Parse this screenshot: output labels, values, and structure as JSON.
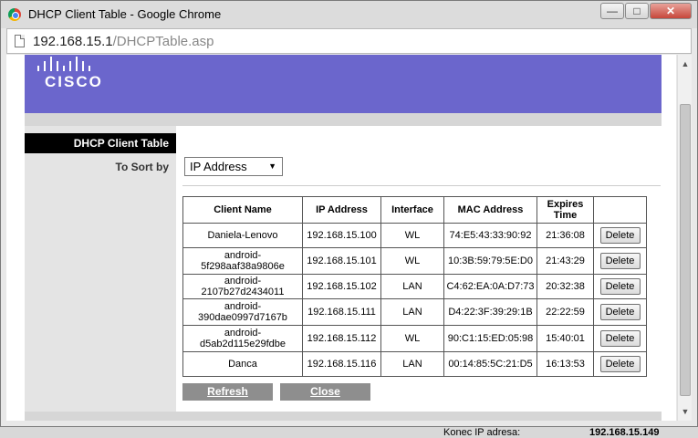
{
  "window": {
    "title": "DHCP Client Table - Google Chrome",
    "minimize": "—",
    "maximize": "□",
    "close": "✕"
  },
  "address": {
    "host": "192.168.15.1",
    "path": "/DHCPTable.asp"
  },
  "brand": {
    "logo_text": "CISCO",
    "color": "#6b66cc"
  },
  "sidebar": {
    "section_title": "DHCP Client Table",
    "sort_label": "To Sort by"
  },
  "sort": {
    "selected": "IP Address"
  },
  "table": {
    "headers": [
      "Client Name",
      "IP Address",
      "Interface",
      "MAC Address",
      "Expires Time"
    ],
    "delete_label": "Delete",
    "rows": [
      {
        "name": "Daniela-Lenovo",
        "ip": "192.168.15.100",
        "iface": "WL",
        "mac": "74:E5:43:33:90:92",
        "expires": "21:36:08"
      },
      {
        "name": "android-\n5f298aaf38a9806e",
        "ip": "192.168.15.101",
        "iface": "WL",
        "mac": "10:3B:59:79:5E:D0",
        "expires": "21:43:29"
      },
      {
        "name": "android-2107b27d2434011",
        "ip": "192.168.15.102",
        "iface": "LAN",
        "mac": "C4:62:EA:0A:D7:73",
        "expires": "20:32:38"
      },
      {
        "name": "android-\n390dae0997d7167b",
        "ip": "192.168.15.111",
        "iface": "LAN",
        "mac": "D4:22:3F:39:29:1B",
        "expires": "22:22:59"
      },
      {
        "name": "android-\nd5ab2d115e29fdbe",
        "ip": "192.168.15.112",
        "iface": "WL",
        "mac": "90:C1:15:ED:05:98",
        "expires": "15:40:01"
      },
      {
        "name": "Danca",
        "ip": "192.168.15.116",
        "iface": "LAN",
        "mac": "00:14:85:5C:21:D5",
        "expires": "16:13:53"
      }
    ]
  },
  "actions": {
    "refresh": "Refresh",
    "close": "Close"
  },
  "background": {
    "label": "Konec IP adresa:",
    "value": "192.168.15.149"
  }
}
